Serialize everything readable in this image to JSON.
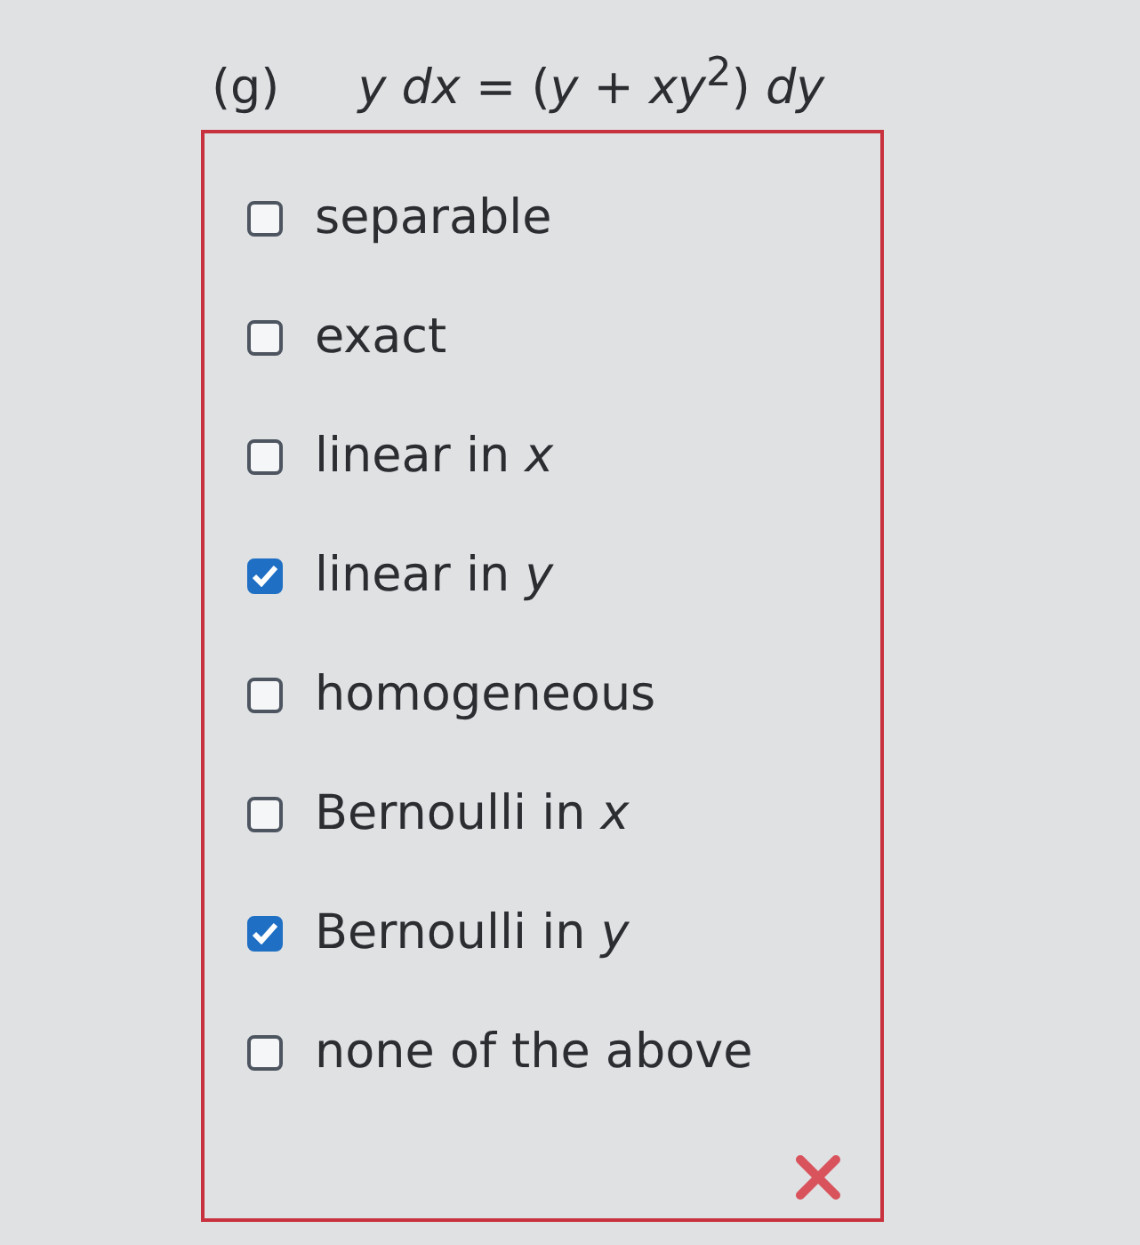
{
  "question": {
    "label": "(g)",
    "equation": "*y dx* = (*y* + *xy*$^{2}$) *dy*"
  },
  "options": [
    {
      "label": "separable",
      "checked": false
    },
    {
      "label": "exact",
      "checked": false
    },
    {
      "label": "linear in *x*",
      "checked": false
    },
    {
      "label": "linear in *y*",
      "checked": true
    },
    {
      "label": "homogeneous",
      "checked": false
    },
    {
      "label": "Bernoulli in *x*",
      "checked": false
    },
    {
      "label": "Bernoulli in *y*",
      "checked": true
    },
    {
      "label": "none of the above",
      "checked": false
    }
  ],
  "feedback": {
    "kind": "incorrect"
  }
}
